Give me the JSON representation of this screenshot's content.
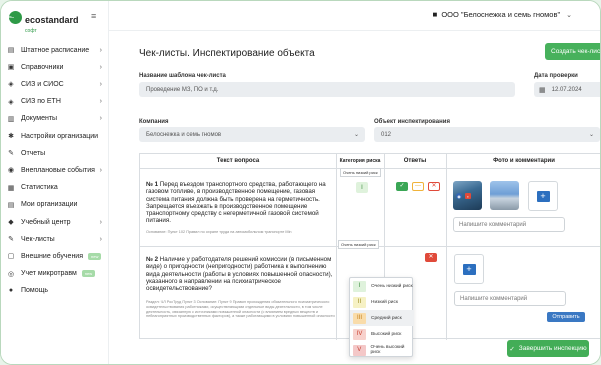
{
  "brand": {
    "name": "ecostandard",
    "sub": "софт"
  },
  "sidebar": {
    "items": [
      {
        "icon": "list-icon",
        "glyph": "▤",
        "label": "Штатное расписание",
        "chevron": true
      },
      {
        "icon": "book-icon",
        "glyph": "▣",
        "label": "Справочники",
        "chevron": true
      },
      {
        "icon": "shield-icon",
        "glyph": "◈",
        "label": "СИЗ и СИОС",
        "chevron": true
      },
      {
        "icon": "shield-icon",
        "glyph": "◈",
        "label": "СИЗ по ЕТН",
        "chevron": true
      },
      {
        "icon": "document-icon",
        "glyph": "▥",
        "label": "Документы",
        "chevron": true
      },
      {
        "icon": "gear-icon",
        "glyph": "✱",
        "label": "Настройки организации",
        "chevron": false
      },
      {
        "icon": "pencil-icon",
        "glyph": "✎",
        "label": "Отчеты",
        "chevron": false
      },
      {
        "icon": "event-icon",
        "glyph": "◉",
        "label": "Внеплановые события",
        "chevron": true
      },
      {
        "icon": "stats-icon",
        "glyph": "▦",
        "label": "Статистика",
        "chevron": false
      },
      {
        "icon": "building-icon",
        "glyph": "▤",
        "label": "Мои организации",
        "chevron": false
      },
      {
        "icon": "education-icon",
        "glyph": "◆",
        "label": "Учебный центр",
        "chevron": true
      },
      {
        "icon": "checklist-icon",
        "glyph": "✎",
        "label": "Чек-листы",
        "chevron": true
      },
      {
        "icon": "training-icon",
        "glyph": "▢",
        "label": "Внешние обучения",
        "chevron": false,
        "badge": "new"
      },
      {
        "icon": "microtraining-icon",
        "glyph": "◎",
        "label": "Учет микротравм",
        "chevron": false,
        "badge": "new"
      },
      {
        "icon": "help-icon",
        "glyph": "●",
        "label": "Помощь",
        "chevron": false
      }
    ]
  },
  "topbar": {
    "org_name": "ООО \"Белоснежка и семь гномов\""
  },
  "page": {
    "title": "Чек-листы. Инспектирование объекта",
    "create_button": "Создать чек-лист",
    "template_label": "Название шаблона чек-листа",
    "template_value": "Проведение МЗ, ПО и т.д.",
    "date_label": "Дата проверки",
    "date_value": "12.07.2024",
    "company_label": "Компания",
    "company_value": "Белоснежка и семь гномов",
    "object_label": "Объект инспектирования",
    "object_value": "012"
  },
  "table": {
    "headers": {
      "question": "Текст вопроса",
      "risk": "Категория риска",
      "answers": "Ответы",
      "photo": "Фото и комментарии"
    },
    "rows": [
      {
        "number": "№ 1",
        "text": "Перед въездом транспортного средства, работающего на газовом топливе, в производственное помещение, газовая система питания должна быть проверена на герметичность. Запрещается въезжать в производственное помещение транспортному средству с негерметичной газовой системой питания.",
        "basis": "Основание: Пункт 102 Правил по охране труда на автомобильном транспорте Min",
        "risk_tooltip": "Очень низкий риск",
        "risk_value": "I",
        "comment_placeholder": "Напишите комментарий"
      },
      {
        "number": "№ 2",
        "text": "Наличие у работодателя решений комиссии (в письменном виде) о пригодности (непригодности) работника к выполнению вида деятельности (работы в условиях повышенной опасности), указанного в направлении на психиатрическое освидетельствование?",
        "basis": "Раздел: ЧЛ РосТруд Пункт 3 Основание: Пункт 9 Правил прохождения обязательного психиатрического освидетельствования работниками, осуществляющими отдельные виды деятельности, в том числе деятельность, связанную с источниками повышенной опасности (с влиянием вредных веществ и неблагоприятных производственных факторов), а также работающими в условиях повышенной опасности",
        "risk_tooltip": "Очень низкий риск",
        "risk_value": "I",
        "comment_placeholder": "Напишите комментарий",
        "send_label": "Отправить"
      }
    ]
  },
  "risk_options": [
    {
      "num": "I",
      "label": "Очень низкий риск",
      "bg": "#dff2dc",
      "fg": "#3a8a3e"
    },
    {
      "num": "II",
      "label": "Низкий риск",
      "bg": "#f6f1c4",
      "fg": "#9a8a1c"
    },
    {
      "num": "III",
      "label": "Средний риск",
      "bg": "#f9dcaa",
      "fg": "#c07a14"
    },
    {
      "num": "IV",
      "label": "Высокий риск",
      "bg": "#f7d1cc",
      "fg": "#c9402f"
    },
    {
      "num": "V",
      "label": "Очень высокий риск",
      "bg": "#f4c8c8",
      "fg": "#c0392b"
    }
  ],
  "finish_button": "Завершить инспекцию",
  "colors": {
    "accent": "#47b15c",
    "blue": "#2c6fbf",
    "danger": "#e04a3a"
  }
}
